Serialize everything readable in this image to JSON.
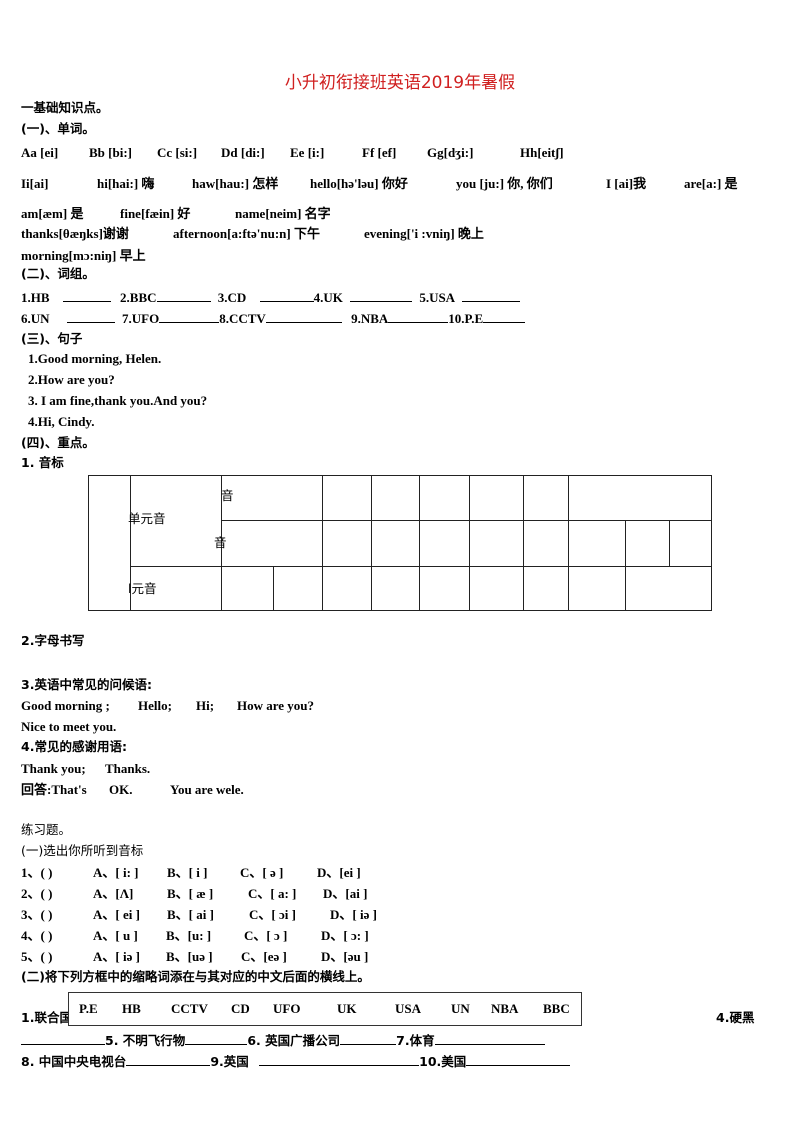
{
  "title": "小升初衔接班英语2019年暑假",
  "s1": {
    "heading": "一基础知识点。",
    "sub1": "(一)、单词。",
    "row1": [
      "Aa [ei]",
      "Bb [bi:]",
      "Cc [si:]",
      "Dd [di:]",
      "Ee [i:]",
      "Ff [ef]",
      "Gg[dʒi:]",
      "Hh[eitʃ]"
    ],
    "row2": [
      "Ii[ai]",
      "hi[hai:] 嗨",
      "haw[hau:] 怎样",
      "hello[hə'ləu] 你好",
      "you [ju:] 你, 你们",
      "I [ai]我",
      "are[a:] 是"
    ],
    "row3": [
      "am[æm] 是",
      "fine[fæin] 好",
      "name[neim] 名字"
    ],
    "row4": [
      "thanks[θæŋks]谢谢",
      "afternoon[a:ftə'nu:n] 下午",
      "evening['i :vniŋ] 晚上"
    ],
    "row5": [
      "morning[mɔ:niŋ] 早上"
    ],
    "sub2": "(二)、词组。",
    "phrases1": [
      "1.HB",
      "2.BBC",
      "3.CD",
      "4.UK",
      "5.USA"
    ],
    "phrases2": [
      "6.UN",
      "7.UFO",
      "8.CCTV",
      "9.NBA",
      "10.P.E"
    ],
    "sub3": "(三)、句子",
    "sentences": [
      "1.Good morning, Helen.",
      "2.How are you?",
      "3. I am fine,thank you.And you?",
      "4.Hi, Cindy."
    ],
    "sub4": "(四)、重点。",
    "p1": "1. 音标",
    "table": {
      "single": "单元音",
      "r1": "音",
      "r2": "音",
      "double": "l元音"
    },
    "p2": "2.字母书写",
    "p3": "3.英语中常见的问候语:",
    "greet": [
      "Good morning ;",
      "Hello;",
      "Hi;",
      "How are you?"
    ],
    "nice": "Nice to meet you.",
    "p4": "4.常见的感谢用语:",
    "thanks": [
      "Thank you;",
      "Thanks."
    ],
    "answer": [
      "回答:That's",
      "OK.",
      "You are wele."
    ]
  },
  "ex": {
    "heading": "练习题。",
    "q1": "(一)选出你所听到音标",
    "items": [
      [
        "1、(     )",
        "A、[ i: ]",
        "B、[ i ]",
        "C、[ ə ]",
        "D、[ei ]"
      ],
      [
        "2、(     )",
        "A、[Λ]",
        "B、[ æ ]",
        "C、[ a: ]",
        "D、[ai ]"
      ],
      [
        "3、(     )",
        "A、[ ei ]",
        "B、[ ai ]",
        "C、[ ɔi ]",
        "D、[ iə ]"
      ],
      [
        "4、(     )",
        "A、[ u ]",
        "B、[u: ]",
        "C、[ ɔ ]",
        "D、[ ɔ: ]"
      ],
      [
        "5、(     )",
        "A、[ iə ]",
        "B、[uə ]",
        "C、[eə ]",
        "D、[əu ]"
      ]
    ],
    "q2": "(二)将下列方框中的缩略词添在与其对应的中文后面的横线上。",
    "box": [
      "P.E",
      "HB",
      "CCTV",
      "CD",
      "UFO",
      "UK",
      "USA",
      "UN",
      "NBA",
      "BBC"
    ],
    "l1a": "1.联合国",
    "l1b": "4.硬黑",
    "l2": [
      "5. 不明飞行物",
      "6. 英国广播公司",
      "7.体育"
    ],
    "l3": [
      "8. 中国中央电视台",
      "9.英国",
      "10.美国"
    ]
  }
}
